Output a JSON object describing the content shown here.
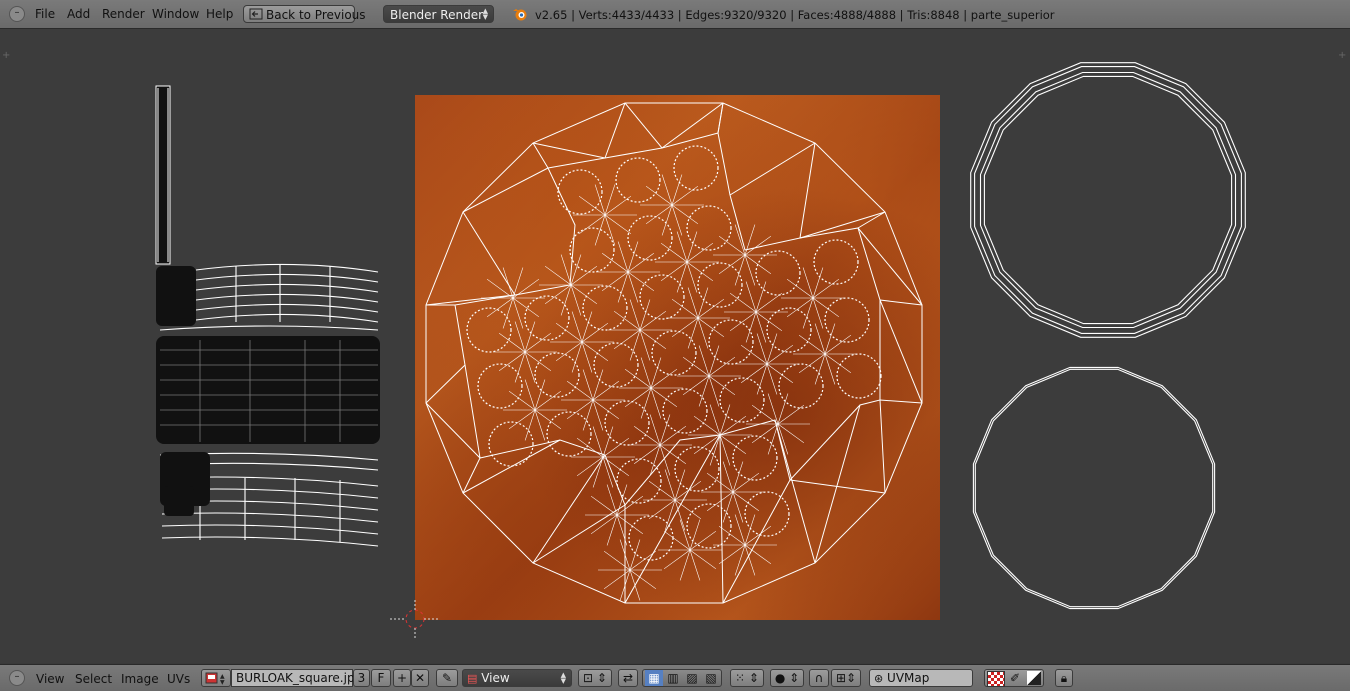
{
  "header": {
    "menus": [
      "File",
      "Add",
      "Render",
      "Window",
      "Help"
    ],
    "back_button": "Back to Previous",
    "render_engine": "Blender Render",
    "stats": "v2.65 | Verts:4433/4433 | Edges:9320/9320 | Faces:4888/4888 | Tris:8848 | parte_superior"
  },
  "footer": {
    "menus": [
      "View",
      "Select",
      "Image",
      "UVs"
    ],
    "image_name": "BURLOAK_square.jpg",
    "users_count": "3",
    "fake_user": "F",
    "view_mode": "View",
    "uv_map": "UVMap"
  },
  "icons": {
    "collapse": "collapse-icon",
    "blender": "blender-logo-icon",
    "image_browse": "image-browse-icon",
    "new_image": "plus-icon",
    "unlink": "close-icon",
    "pin": "pin-icon",
    "pivot": "pivot-icon",
    "sync": "uv-sync-icon",
    "select_modes": [
      "vertex-select-icon",
      "edge-select-icon",
      "face-select-icon",
      "island-select-icon"
    ],
    "sticky": "sticky-select-icon",
    "proportional": "proportional-edit-icon",
    "snap": "snap-magnet-icon",
    "snap_target": "snap-target-icon",
    "uvmap": "uvmap-icon",
    "paint": [
      "checker-icon",
      "brush-icon",
      "gradient-icon"
    ],
    "lock": "lock-icon"
  },
  "colors": {
    "header_bg": "#727272",
    "viewport_bg": "#3c3c3c",
    "texture_tone": "#a8481a",
    "uv_edge": "#ffffff",
    "uv_vertex": "#000000"
  }
}
